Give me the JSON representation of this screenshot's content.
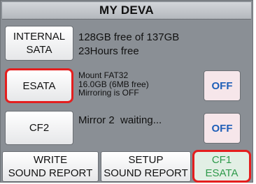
{
  "header": {
    "title": "MY DEVA"
  },
  "drives": {
    "internal": {
      "label_line1": "INTERNAL",
      "label_line2": "SATA",
      "free_text": "128GB free of 137GB",
      "time_text": "23Hours free"
    },
    "esata": {
      "label": "ESATA",
      "mount_text": "Mount FAT32",
      "size_text": "16.0GB (6MB free)",
      "mirror_text": "Mirroring is OFF",
      "toggle_label": "OFF"
    },
    "cf2": {
      "label": "CF2",
      "status_text": "Mirror 2  waiting...",
      "toggle_label": "OFF"
    }
  },
  "footer": {
    "write": {
      "line1": "WRITE",
      "line2": "SOUND REPORT"
    },
    "setup": {
      "line1": "SETUP",
      "line2": "SOUND REPORT"
    },
    "cf1": {
      "line1": "CF1",
      "line2": "ESATA"
    }
  },
  "colors": {
    "frame": "#8a8f95",
    "highlight": "#e41e1e",
    "off_text": "#1f5fb8",
    "off_bg": "#f6e6ea",
    "cf1_text": "#2e9a4b",
    "cf1_bg": "#e2efe5"
  }
}
